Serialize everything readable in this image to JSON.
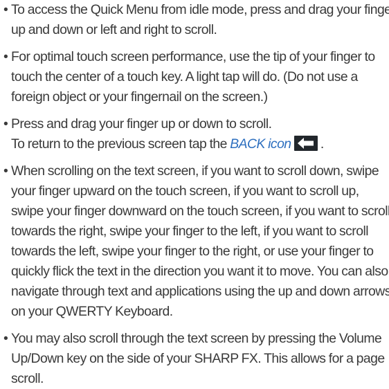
{
  "bullet_glyph": "•",
  "bullets": [
    {
      "lines": [
        "To access the Quick Menu from idle mode, press and drag your finger",
        "up and down or left and right to scroll."
      ]
    },
    {
      "lines": [
        "For optimal touch screen performance, use the tip of your finger to",
        "touch the center of a touch key. A light tap will do. (Do not use a",
        "foreign object or your fingernail on the screen.)"
      ]
    },
    {
      "line1": "Press and drag your finger up or down to scroll.",
      "line2_prefix": "To return to the previous screen tap the ",
      "back_link": "BACK icon",
      "back_icon": "back-arrow-icon",
      "line2_suffix": " ."
    },
    {
      "lines": [
        "When scrolling on the text screen, if you want to scroll down, swipe",
        "your finger upward on the touch screen, if you want to scroll up,",
        "swipe your finger downward on the touch screen, if you want to scroll",
        "towards the right, swipe your finger to the left, if you want to scroll",
        "towards the left, swipe your finger to the right, or use your finger to",
        "quickly flick the text in the direction you want it to move. You can also",
        "navigate through text and applications using the up and down arrows",
        "on your QWERTY Keyboard."
      ]
    },
    {
      "lines": [
        "You may also scroll through the text screen by pressing the Volume",
        "Up/Down key on the side of your SHARP FX. This allows for a page",
        "scroll."
      ]
    }
  ],
  "colors": {
    "text": "#3a3a3a",
    "link": "#2d6fbf",
    "icon_bg": "#22272c"
  }
}
